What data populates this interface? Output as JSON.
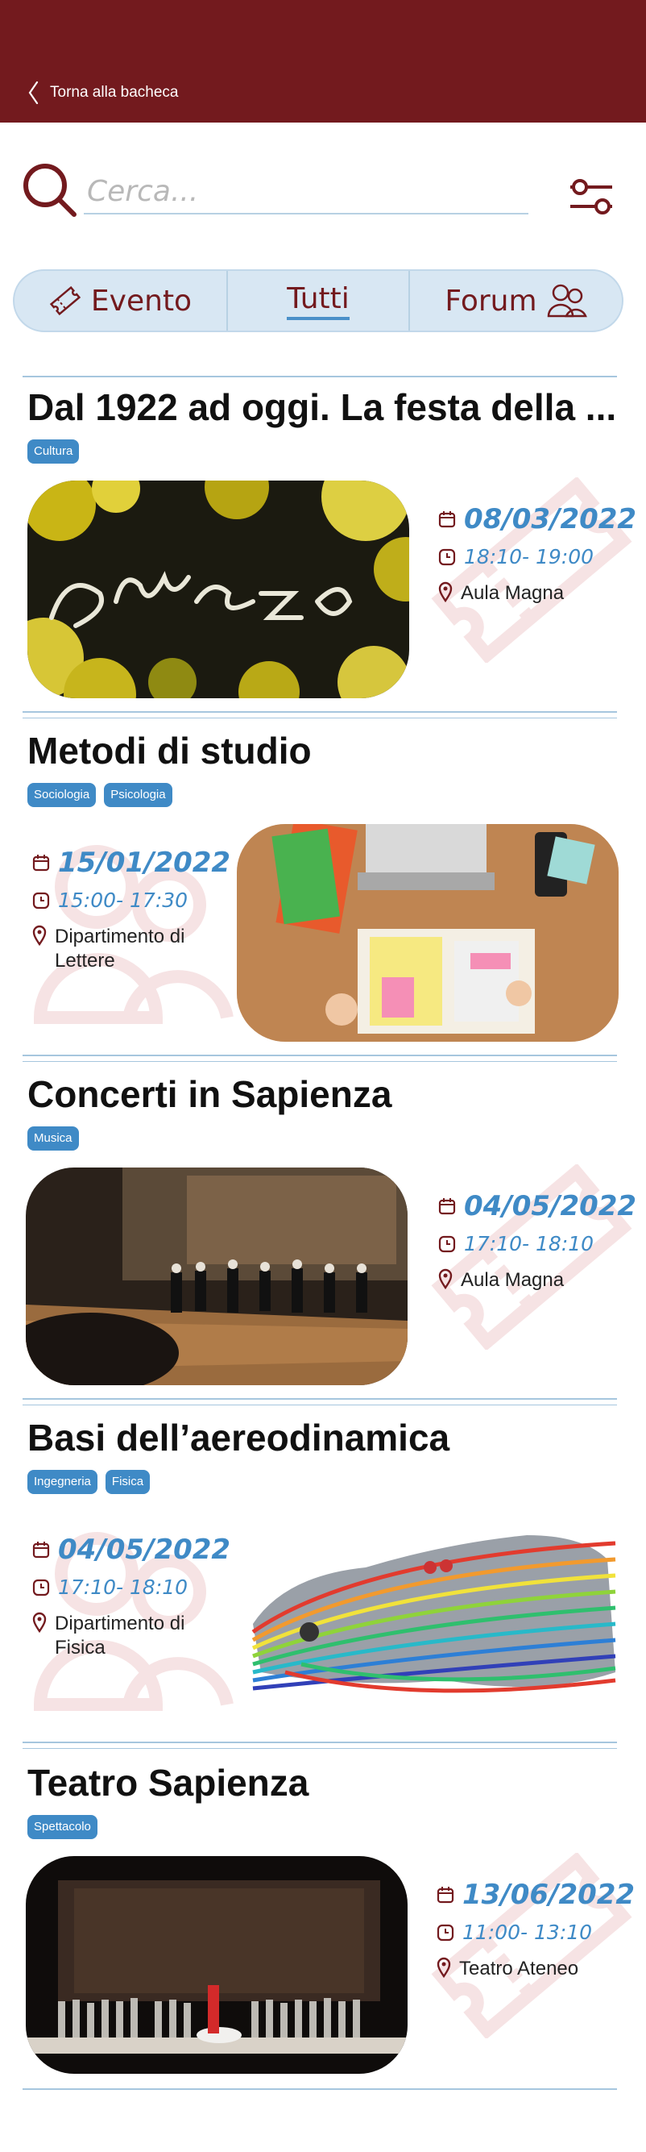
{
  "header": {
    "back_label": "Torna alla bacheca"
  },
  "search": {
    "placeholder": "Cerca..."
  },
  "tabs": [
    {
      "label": "Evento"
    },
    {
      "label": "Tutti"
    },
    {
      "label": "Forum"
    }
  ],
  "colors": {
    "brand": "#731a1e",
    "accent": "#3f8ac6",
    "tab_bg": "#d8e7f3",
    "divider": "#a6c6de"
  },
  "events": [
    {
      "title": "Dal 1922 ad oggi. La festa della ...",
      "tags": [
        "Cultura"
      ],
      "date": "08/03/2022",
      "time": "18:10- 19:00",
      "place": "Aula Magna",
      "image": "mimosa-8-marzo"
    },
    {
      "title": "Metodi di studio",
      "tags": [
        "Sociologia",
        "Psicologia"
      ],
      "date": "15/01/2022",
      "time": "15:00- 17:30",
      "place": "Dipartimento di Lettere",
      "image": "study-desk"
    },
    {
      "title": "Concerti in Sapienza",
      "tags": [
        "Musica"
      ],
      "date": "04/05/2022",
      "time": "17:10- 18:10",
      "place": "Aula Magna",
      "image": "concert-hall"
    },
    {
      "title": "Basi dell’aereodinamica",
      "tags": [
        "Ingegneria",
        "Fisica"
      ],
      "date": "04/05/2022",
      "time": "17:10- 18:10",
      "place": "Dipartimento di Fisica",
      "image": "car-airflow"
    },
    {
      "title": "Teatro Sapienza",
      "tags": [
        "Spettacolo"
      ],
      "date": "13/06/2022",
      "time": "11:00- 13:10",
      "place": "Teatro Ateneo",
      "image": "theatre-stage"
    }
  ]
}
